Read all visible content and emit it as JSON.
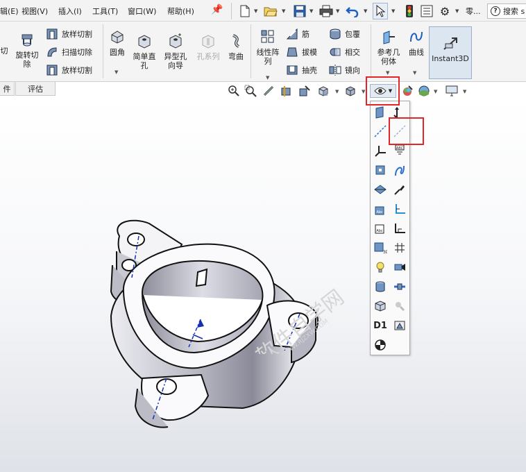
{
  "menu": {
    "items": [
      "辑(E)",
      "视图(V)",
      "插入(I)",
      "工具(T)",
      "窗口(W)",
      "帮助(H)"
    ]
  },
  "quick_access": {
    "overflow_label": "零...",
    "search_placeholder": "搜索 s"
  },
  "ribbon": {
    "cut_partial": "切",
    "revolve_cut": "旋转切\n除",
    "loft_cut_1": "放样切割",
    "sweep_cut": "扫描切除",
    "loft_cut_2": "放样切割",
    "fillet": "圆角",
    "simple_hole": "简单直\n孔",
    "hole_wizard": "异型孔\n向导",
    "hole_series": "孔系列",
    "flex": "弯曲",
    "linear_pattern": "线性阵\n列",
    "rib": "筋",
    "draft": "拔模",
    "shell": "抽壳",
    "wrap": "包覆",
    "intersect": "相交",
    "mirror": "镜向",
    "ref_geometry": "参考几\n何体",
    "curves": "曲线",
    "instant3d": "Instant3D"
  },
  "tabs": {
    "partial": "件",
    "evaluate": "评估"
  },
  "flyout": {
    "d1_label": "D1"
  },
  "watermark": {
    "text": "软件自学网",
    "url": "WWW.RJZXW.COM"
  },
  "colors": {
    "highlight": "#e0262a",
    "accent_blue": "#2a6fd1"
  }
}
